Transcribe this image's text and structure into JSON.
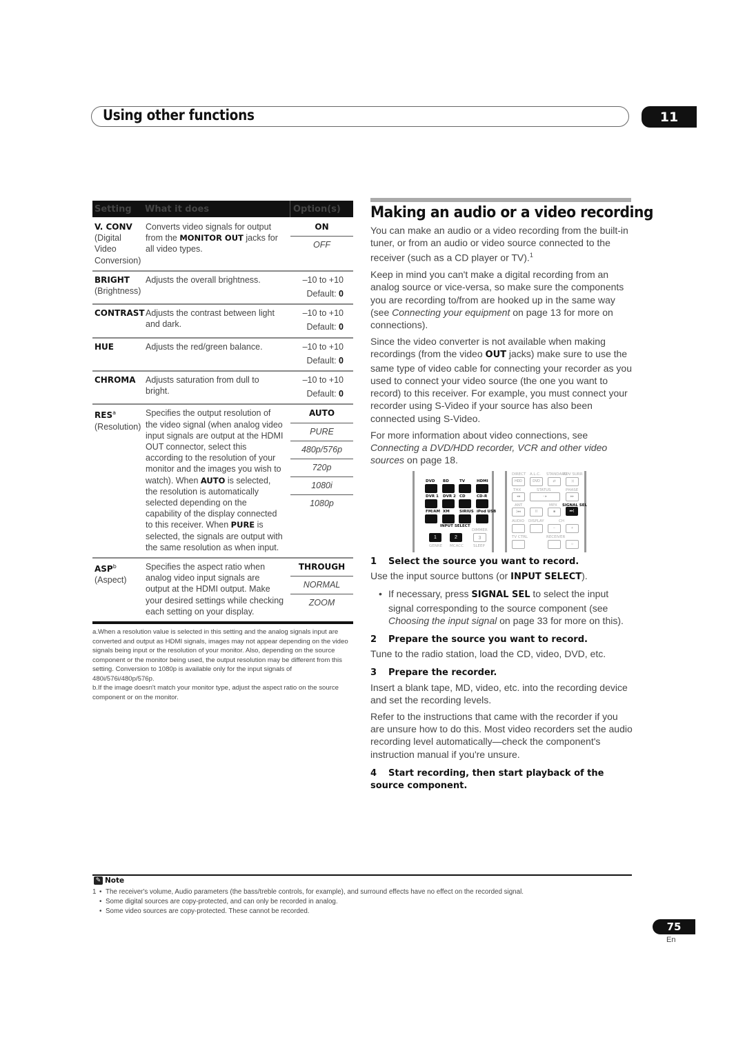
{
  "header": {
    "title": "Using other functions",
    "chapter_number": "11"
  },
  "settings_table": {
    "columns": [
      "Setting",
      "What it does",
      "Option(s)"
    ],
    "rows": [
      {
        "name": "V. CONV",
        "sup": "",
        "sub": "(Digital Video Conversion)",
        "desc_parts": [
          "Converts video signals for output from the ",
          "MONITOR OUT",
          " jacks for all video types."
        ],
        "options": [
          {
            "label": "ON",
            "style": "bold"
          },
          {
            "label": "OFF",
            "style": "italic"
          }
        ]
      },
      {
        "name": "BRIGHT",
        "sup": "",
        "sub": "(Brightness)",
        "desc": "Adjusts the overall brightness.",
        "range": "–10 to +10",
        "default_label": "Default: ",
        "default_value": "0"
      },
      {
        "name": "CONTRAST",
        "sup": "",
        "sub": "",
        "desc": "Adjusts the contrast between light and dark.",
        "range": "–10 to +10",
        "default_label": "Default: ",
        "default_value": "0"
      },
      {
        "name": "HUE",
        "sup": "",
        "sub": "",
        "desc": "Adjusts the red/green balance.",
        "range": "–10 to +10",
        "default_label": "Default: ",
        "default_value": "0"
      },
      {
        "name": "CHROMA",
        "sup": "",
        "sub": "",
        "desc": "Adjusts saturation from dull to bright.",
        "range": "–10 to +10",
        "default_label": "Default: ",
        "default_value": "0"
      },
      {
        "name": "RES",
        "sup": "a",
        "sub": "(Resolution)",
        "desc_parts": [
          "Specifies the output resolution of the video signal (when analog video input signals are output at the HDMI OUT connector, select this according to the resolution of your monitor and the images you wish to watch). When ",
          "AUTO",
          " is selected, the resolution is automatically selected depending on the capability of the display connected to this receiver. When ",
          "PURE",
          " is selected, the signals are output with the same resolution as when input."
        ],
        "options": [
          {
            "label": "AUTO",
            "style": "bold"
          },
          {
            "label": "PURE",
            "style": "italic"
          },
          {
            "label": "480p/576p",
            "style": "italic"
          },
          {
            "label": "720p",
            "style": "italic"
          },
          {
            "label": "1080i",
            "style": "italic"
          },
          {
            "label": "1080p",
            "style": "italic"
          }
        ]
      },
      {
        "name": "ASP",
        "sup": "b",
        "sub": "(Aspect)",
        "desc": "Specifies the aspect ratio when analog video input signals are output at the HDMI output. Make your desired settings while checking each setting on your display.",
        "options": [
          {
            "label": "THROUGH",
            "style": "bold"
          },
          {
            "label": "NORMAL",
            "style": "italic"
          },
          {
            "label": "ZOOM",
            "style": "italic"
          }
        ]
      }
    ],
    "footnotes": [
      "a.When a resolution value is selected in this setting and the analog signals input are converted and output as HDMI signals, images may not appear depending on the video signals being input or the resolution of your monitor. Also, depending on the source component or the monitor being used, the output resolution may be different from this setting. Conversion to 1080p is available only for the input signals of 480i/576i/480p/576p.",
      "b.If the image doesn't match your monitor type, adjust the aspect ratio on the source component or on the monitor."
    ]
  },
  "recording": {
    "title": "Making an audio or a video recording",
    "intro": "You can make an audio or a video recording from the built-in tuner, or from an audio or video source connected to the receiver (such as a CD player or TV).",
    "intro_ref": "1",
    "p2_a": "Keep in mind you can't make a digital recording from an analog source or vice-versa, so make sure the components you are recording to/from are hooked up in the same way (see ",
    "p2_link": "Connecting your equipment",
    "p2_b": " on page 13 for more on connections).",
    "p3_a": "Since the video converter is not available when making recordings (from the video ",
    "p3_bold": "OUT",
    "p3_b": " jacks) make sure to use the same type of video cable for connecting your recorder as you used to connect your video source (the one you want to record) to this receiver. For example, you must connect your recorder using S-Video if your source has also been connected using S-Video.",
    "p4_a": "For more information about video connections, see ",
    "p4_link": "Connecting a DVD/HDD recorder, VCR and other video sources",
    "p4_b": " on page 18.",
    "steps": [
      {
        "num": "1",
        "title": "Select the source you want to record.",
        "body_a": "Use the input source buttons (or ",
        "body_bold": "INPUT SELECT",
        "body_b": ").",
        "bullet_a": "If necessary, press ",
        "bullet_bold": "SIGNAL SEL",
        "bullet_b": " to select the input signal corresponding to the source component (see ",
        "bullet_link": "Choosing the input signal",
        "bullet_c": " on page 33 for more on this)."
      },
      {
        "num": "2",
        "title": "Prepare the source you want to record.",
        "body": "Tune to the radio station, load the CD, video, DVD, etc."
      },
      {
        "num": "3",
        "title": "Prepare the recorder.",
        "body": "Insert a blank tape, MD, video, etc. into the recording device and set the recording levels.",
        "body2": "Refer to the instructions that came with the recorder if you are unsure how to do this. Most video recorders set the audio recording level automatically—check the component's instruction manual if you're unsure."
      },
      {
        "num": "4",
        "title": "Start recording, then start playback of the source component."
      }
    ]
  },
  "remote": {
    "left_rows": [
      [
        "DVD",
        "BD",
        "TV",
        "HDMI"
      ],
      [
        "DVR 1",
        "DVR 2",
        "CD",
        "CD-R"
      ],
      [
        "FM/AM",
        "XM",
        "SIRIUS",
        "iPod USB"
      ]
    ],
    "input_select_label": "INPUT SELECT",
    "numbers": [
      "1",
      "2",
      "3"
    ],
    "dimmer": "DIMMER",
    "bottom_labels": [
      "GENRE",
      "MCACC",
      "SLEEP"
    ],
    "right_labels": {
      "row1": [
        "DIRECT",
        "A.L.C.",
        "STANDARD",
        "ADV SURR"
      ],
      "row1_btn": [
        "HDD",
        "DVD"
      ],
      "row2": [
        "THX",
        "STATUS",
        "PHASE"
      ],
      "row3": [
        "ANT",
        "MPX",
        "SIGNAL SEL"
      ],
      "row4": [
        "AUDIO",
        "DISPLAY",
        "CH"
      ],
      "row5": [
        "TV CTRL",
        "RECEIVER"
      ]
    }
  },
  "note": {
    "heading": "Note",
    "items": [
      {
        "num": "1",
        "text": "The receiver's volume, Audio parameters (the bass/treble controls, for example), and surround effects have no effect on the recorded signal."
      },
      {
        "num": "",
        "text": "Some digital sources are copy-protected, and can only be recorded in analog."
      },
      {
        "num": "",
        "text": "Some video sources are copy-protected. These cannot be recorded."
      }
    ]
  },
  "footer": {
    "page_number": "75",
    "language": "En"
  }
}
